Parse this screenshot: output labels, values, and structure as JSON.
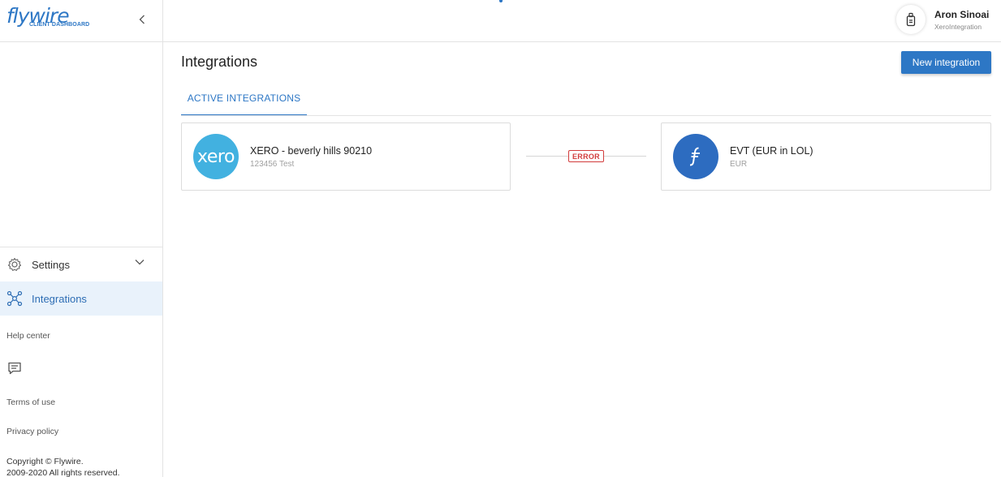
{
  "brand": {
    "name": "flywire",
    "subtitle": "CLIENT DASHBOARD",
    "color": "#2d77c5"
  },
  "sidebar": {
    "collapse_icon": "chevron-left-icon",
    "items": [
      {
        "label": "Settings",
        "icon": "gear-icon",
        "expandable": true
      },
      {
        "label": "Integrations",
        "icon": "network-icon",
        "active": true
      }
    ],
    "links": {
      "help_center": "Help center",
      "terms": "Terms of use",
      "privacy": "Privacy policy"
    },
    "chat_icon": "chat-icon",
    "copyright_line1": "Copyright © Flywire.",
    "copyright_line2": "2009-2020 All rights reserved."
  },
  "header": {
    "user": {
      "name": "Aron Sinoai",
      "org": "XeroIntegration",
      "avatar_icon": "badge-icon"
    }
  },
  "main": {
    "title": "Integrations",
    "new_button": "New integration",
    "tabs": [
      {
        "label": "ACTIVE INTEGRATIONS",
        "active": true
      }
    ],
    "integration": {
      "source": {
        "logo_text": "xero",
        "title": "XERO - beverly hills 90210",
        "subtitle": "123456 Test",
        "logo_color": "#42b1e0"
      },
      "status": {
        "label": "ERROR",
        "color": "#d23c3c"
      },
      "target": {
        "title": "EVT (EUR in LOL)",
        "subtitle": "EUR",
        "logo_color": "#2d6cc0"
      }
    }
  }
}
